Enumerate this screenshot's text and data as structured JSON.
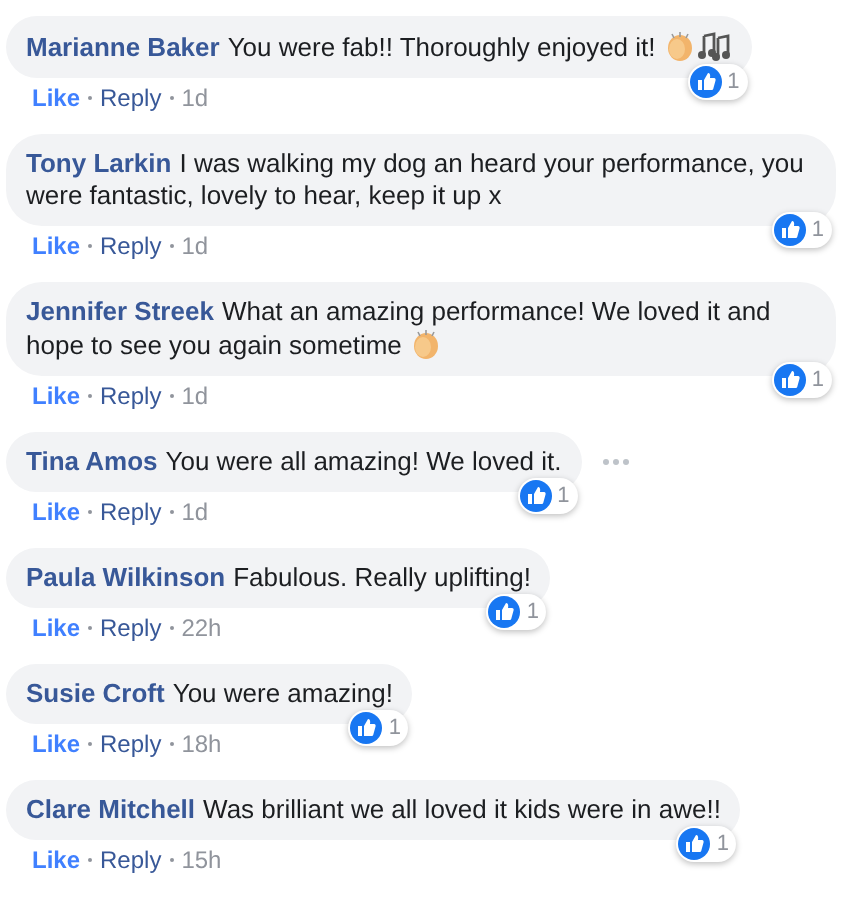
{
  "comments": [
    {
      "author": "Marianne Baker",
      "text": "You were fab!! Thoroughly enjoyed it!",
      "trailing_icons": [
        {
          "kind": "clap"
        },
        {
          "kind": "notes"
        }
      ],
      "reaction_count": "1",
      "liked": true,
      "like_label": "Like",
      "reply_label": "Reply",
      "time": "1d",
      "show_menu": false
    },
    {
      "author": "Tony Larkin",
      "text": "I was walking my dog an heard your performance, you were fantastic, lovely to hear, keep it up x",
      "reaction_count": "1",
      "liked": true,
      "like_label": "Like",
      "reply_label": "Reply",
      "time": "1d",
      "show_menu": false
    },
    {
      "author": "Jennifer Streek",
      "text": "What an amazing performance! We loved it and hope to see you again sometime",
      "trailing_icons": [
        {
          "kind": "clap"
        }
      ],
      "reaction_count": "1",
      "liked": true,
      "like_label": "Like",
      "reply_label": "Reply",
      "time": "1d",
      "show_menu": false
    },
    {
      "author": "Tina Amos",
      "text": "You were all amazing! We loved it.",
      "reaction_count": "1",
      "liked": true,
      "like_label": "Like",
      "reply_label": "Reply",
      "time": "1d",
      "show_menu": true
    },
    {
      "author": "Paula Wilkinson",
      "text": "Fabulous. Really uplifting!",
      "reaction_count": "1",
      "liked": true,
      "like_label": "Like",
      "reply_label": "Reply",
      "time": "22h",
      "show_menu": false
    },
    {
      "author": "Susie Croft",
      "text": "You were amazing!",
      "reaction_count": "1",
      "liked": true,
      "like_label": "Like",
      "reply_label": "Reply",
      "time": "18h",
      "show_menu": false
    },
    {
      "author": "Clare Mitchell",
      "text": "Was brilliant we all loved it kids were in awe!!",
      "reaction_count": "1",
      "liked": true,
      "like_label": "Like",
      "reply_label": "Reply",
      "time": "15h",
      "show_menu": false
    }
  ]
}
